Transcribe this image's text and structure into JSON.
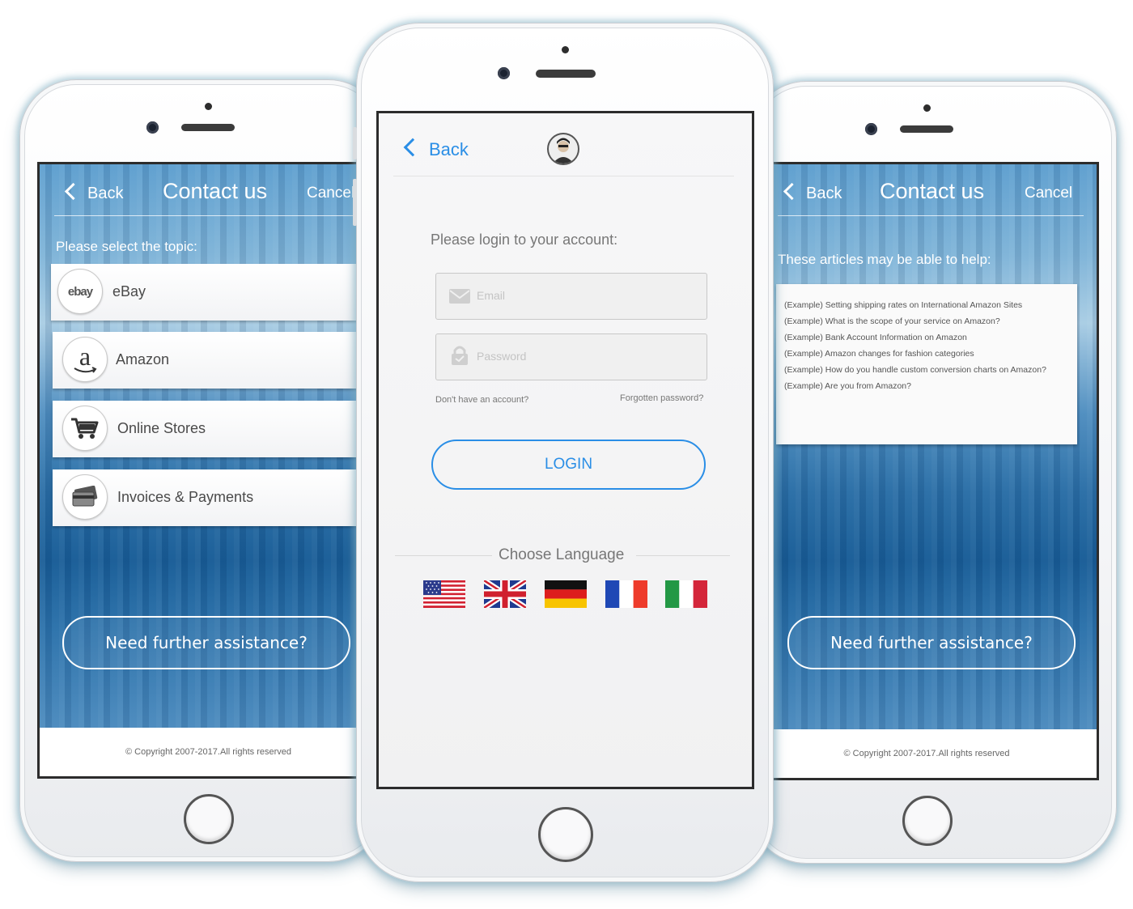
{
  "left_screen": {
    "nav": {
      "back": "Back",
      "title": "Contact us",
      "cancel": "Cancel"
    },
    "topic_label": "Please select the topic:",
    "topics": [
      {
        "label": "eBay",
        "icon": "ebay-logo-icon",
        "icon_text": "ebay"
      },
      {
        "label": "Amazon",
        "icon": "amazon-logo-icon",
        "icon_text": "a"
      },
      {
        "label": "Online Stores",
        "icon": "shopping-cart-icon"
      },
      {
        "label": "Invoices & Payments",
        "icon": "credit-card-icon"
      }
    ],
    "assist_button": "Need further assistance?",
    "footer": "© Copyright 2007-2017.All rights reserved"
  },
  "center_screen": {
    "back": "Back",
    "avatar_icon": "user-avatar-icon",
    "prompt": "Please login to your account:",
    "email_placeholder": "Email",
    "password_placeholder": "Password",
    "no_account": "Don't have an account?",
    "forgot": "Forgotten password?",
    "login_button": "LOGIN",
    "language_label": "Choose Language",
    "languages": [
      "us-flag-icon",
      "uk-flag-icon",
      "german-flag-icon",
      "french-flag-icon",
      "italian-flag-icon"
    ],
    "accent_color": "#2a8ee6"
  },
  "right_screen": {
    "nav": {
      "back": "Back",
      "title": "Contact us",
      "cancel": "Cancel"
    },
    "articles_label": "These articles may be able to help:",
    "articles": [
      "(Example) Setting shipping rates on International Amazon Sites",
      "(Example) What is the scope of your service on Amazon?",
      "(Example) Bank Account Information on Amazon",
      "(Example) Amazon changes for fashion categories",
      "(Example) How do you handle custom conversion charts on Amazon?",
      "(Example) Are you from Amazon?"
    ],
    "assist_button": "Need further assistance?",
    "footer": "© Copyright 2007-2017.All rights reserved"
  }
}
